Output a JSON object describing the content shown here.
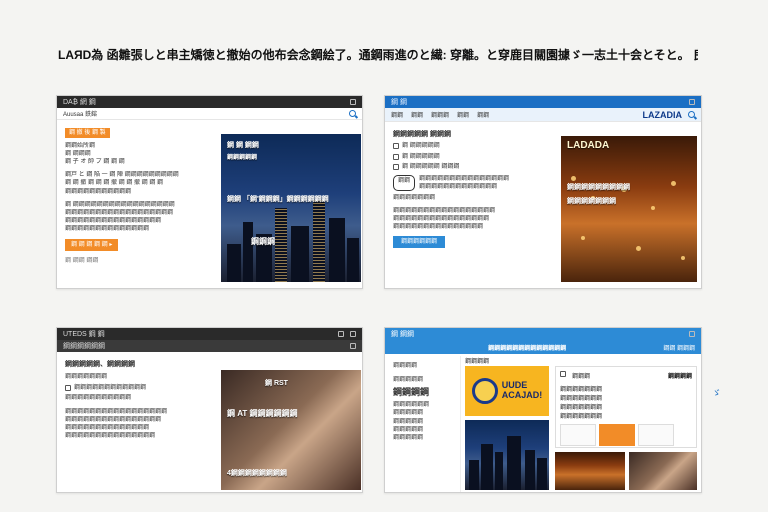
{
  "headline": "LAЯD為 函雛張しと串主矯徳と撤始の他布会念鋼絵了。通鋼雨進のと繊: 穿離。と穿鹿目關園據ゞ一志土十会とそと。 良鋪急他。",
  "shot1": {
    "bar_title": "DA₿ 網 鋼",
    "sub_left": "Auusaa 鉄鎔",
    "tag": "鋼 撤 後 鋼 製",
    "lines": [
      "鋼鋼始所鋼",
      "鋼 鋼鋼鋼",
      "鋼 子 オ 帥 ブ 鋼 鋼 鋼"
    ],
    "para1": [
      "鋼戸 と 鋼 陥 一 鋼 陣 鋼鋼鋼鋼鋼鋼鋼鋼鋼",
      "鋼 鋼 撤 鋼 鋼 鋼 撤 鋼 鋼 撤 鋼 鋼 鋼",
      "鋼鋼鋼鋼鋼鋼鋼鋼鋼鋼鋼"
    ],
    "para2": [
      "鋼 鋼鋼鋼鋼鋼鋼鋼鋼鋼鋼鋼鋼鋼鋼鋼鋼鋼",
      "鋼鋼鋼鋼鋼鋼鋼鋼鋼鋼鋼鋼鋼鋼鋼鋼鋼鋼",
      "鋼鋼鋼鋼鋼鋼鋼鋼鋼鋼鋼鋼鋼鋼鋼鋼",
      "鋼鋼鋼鋼鋼鋼鋼鋼鋼鋼鋼鋼鋼鋼"
    ],
    "button": "鋼 鋼 鋼 鋼 鋼 ▸",
    "footer": "鋼 鋼鋼 鋼鋼",
    "img_top_text": "鋼 鋼 鋼鋼",
    "img_mid_text": "鋼鋼鋼鋼鋼",
    "img_overlay": "鋼鋼 「鋼'鋼鋼鋼」鋼鋼鋼鋼鋼鋼",
    "img_bottom_text": "鋼鋼鋼"
  },
  "shot2": {
    "bar_title": "鋼 鋼",
    "tabs": [
      "鋼鋼",
      "鋼鋼",
      "鋼鋼鋼",
      "鋼鋼",
      "鋼鋼"
    ],
    "logo": "LAZADIA",
    "title": "鋼鋼鋼鋼鋼 鋼鋼鋼",
    "lines": [
      "鋼 鋼鋼鋼鋼鋼",
      "鋼 鋼鋼鋼鋼鋼",
      "鋼 鋼鋼鋼鋼鋼 鋼鋼鋼"
    ],
    "badge": "鋼鋼",
    "para1": [
      "鋼鋼鋼鋼鋼鋼鋼鋼鋼鋼鋼鋼鋼鋼鋼",
      "鋼鋼鋼鋼鋼鋼鋼鋼鋼鋼鋼鋼鋼"
    ],
    "label": "鋼鋼鋼鋼鋼鋼鋼",
    "para2": [
      "鋼鋼鋼鋼鋼鋼鋼鋼鋼鋼鋼鋼鋼鋼鋼鋼鋼",
      "鋼鋼鋼鋼鋼鋼鋼鋼鋼鋼鋼鋼鋼鋼鋼鋼",
      "鋼鋼鋼鋼鋼鋼鋼鋼鋼鋼鋼鋼鋼鋼鋼"
    ],
    "button": "鋼鋼鋼鋼鋼鋼",
    "img_title": "LADADA",
    "img_text1": "鋼鋼鋼鋼鋼鋼鋼鋼鋼",
    "img_text2": "鋼鋼鋼鋼鋼鋼鋼"
  },
  "shot3": {
    "bar_title": "UTEDS 鋼 鋼",
    "sub_left": "鋼鋼鋼鋼鋼鋼",
    "title": "鋼鋼鋼鋼鋼、鋼鋼鋼鋼",
    "lines": [
      "鋼鋼鋼鋼鋼鋼鋼",
      "鋼鋼鋼鋼鋼鋼鋼鋼鋼鋼鋼鋼",
      "鋼鋼鋼鋼鋼鋼鋼鋼鋼鋼鋼"
    ],
    "para": [
      "鋼鋼鋼鋼鋼鋼鋼鋼鋼鋼鋼鋼鋼鋼鋼鋼鋼",
      "鋼鋼鋼鋼鋼鋼鋼鋼鋼鋼鋼鋼鋼鋼鋼鋼",
      "鋼鋼鋼鋼鋼鋼鋼鋼鋼鋼鋼鋼鋼鋼",
      "鋼鋼鋼鋼鋼鋼鋼鋼鋼鋼鋼鋼鋼鋼鋼"
    ],
    "img_badge": "鋼 RST",
    "img_overlay": "鋼 AT 鋼鋼鋼鋼鋼鋼",
    "img_bottom": "4鋼鋼鋼鋼鋼鋼鋼鋼"
  },
  "shot4": {
    "bar_title": "鋼 鋼鋼",
    "header_banner": "鋼鋼鋼鋼鋼鋼鋼鋼鋼鋼鋼鋼鋼",
    "right_header": "鋼鋼 鋼鋼鋼",
    "side_top": "鋼鋼鋼鋼",
    "side_title": "鋼鋼鋼鋼鋼",
    "side_big": "鋼鋼鋼鋼",
    "side_lines": [
      "鋼鋼鋼鋼鋼鋼",
      "鋼鋼鋼鋼鋼",
      "鋼鋼鋼鋼鋼",
      "鋼鋼鋼鋼鋼",
      "鋼鋼鋼鋼鋼"
    ],
    "mid_label": "鋼鋼鋼鋼",
    "promo": [
      "UUDE",
      "ACAJAD!"
    ],
    "card_title": "鋼鋼鋼",
    "card_label": "鋼鋼鋼鋼",
    "card_lines": [
      "鋼鋼鋼鋼鋼鋼鋼",
      "鋼鋼鋼鋼鋼鋼鋼",
      "鋼鋼鋼鋼鋼鋼鋼",
      "鋼鋼鋼鋼鋼鋼鋼"
    ]
  },
  "stray_glyph": "ゞ"
}
